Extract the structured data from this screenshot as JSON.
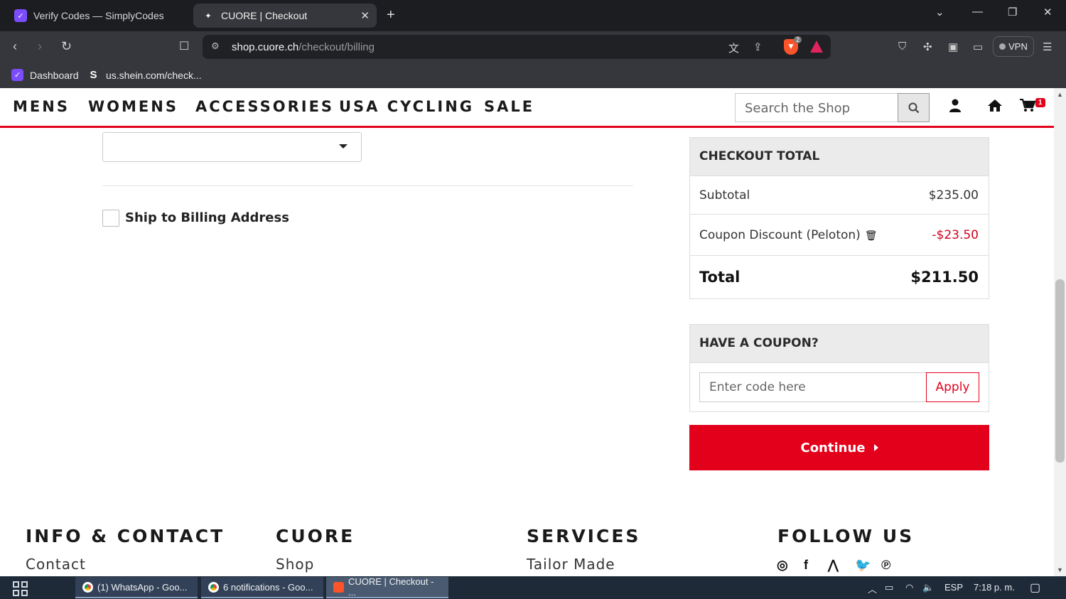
{
  "browser": {
    "tabs": [
      {
        "title": "Verify Codes — SimplyCodes",
        "icon": "simplycodes-icon"
      },
      {
        "title": "CUORE | Checkout",
        "icon": "cuore-icon",
        "active": true
      }
    ],
    "url_domain": "shop.cuore.ch",
    "url_path": "/checkout/billing",
    "brave_count": "2",
    "vpn_label": "VPN",
    "bookmarks": [
      {
        "label": "Dashboard",
        "icon": "simplycodes-icon"
      },
      {
        "label": "us.shein.com/check...",
        "icon_text": "S"
      }
    ]
  },
  "site": {
    "menu": [
      "MENS",
      "WOMENS",
      "ACCESSORIES",
      "USA CYCLING",
      "SALE"
    ],
    "search_placeholder": "Search the Shop",
    "cart_count": "1",
    "accent_color": "#e3001b"
  },
  "billing": {
    "ship_to_billing_label": "Ship to Billing Address",
    "ship_to_billing_checked": false
  },
  "checkout_total": {
    "heading": "CHECKOUT TOTAL",
    "subtotal_label": "Subtotal",
    "subtotal_value": "$235.00",
    "discount_label": "Coupon Discount (Peloton)",
    "discount_value": "-$23.50",
    "total_label": "Total",
    "total_value": "$211.50"
  },
  "coupon": {
    "heading": "HAVE A COUPON?",
    "placeholder": "Enter code here",
    "apply_label": "Apply"
  },
  "continue_label": "Continue",
  "footer": {
    "columns": [
      {
        "heading": "INFO & CONTACT",
        "link": "Contact"
      },
      {
        "heading": "CUORE",
        "link": "Shop"
      },
      {
        "heading": "SERVICES",
        "link": "Tailor Made"
      },
      {
        "heading": "FOLLOW US"
      }
    ],
    "social_icons": [
      "instagram-icon",
      "facebook-icon",
      "strava-icon",
      "twitter-icon",
      "pinterest-icon"
    ]
  },
  "taskbar": {
    "tasks": [
      {
        "label": "(1) WhatsApp - Goo...",
        "icon": "chrome-icon"
      },
      {
        "label": "6 notifications - Goo...",
        "icon": "chrome-icon"
      },
      {
        "label": "CUORE | Checkout - ...",
        "icon": "brave-icon",
        "active": true
      }
    ],
    "language": "ESP",
    "time": "7:18 p. m."
  }
}
